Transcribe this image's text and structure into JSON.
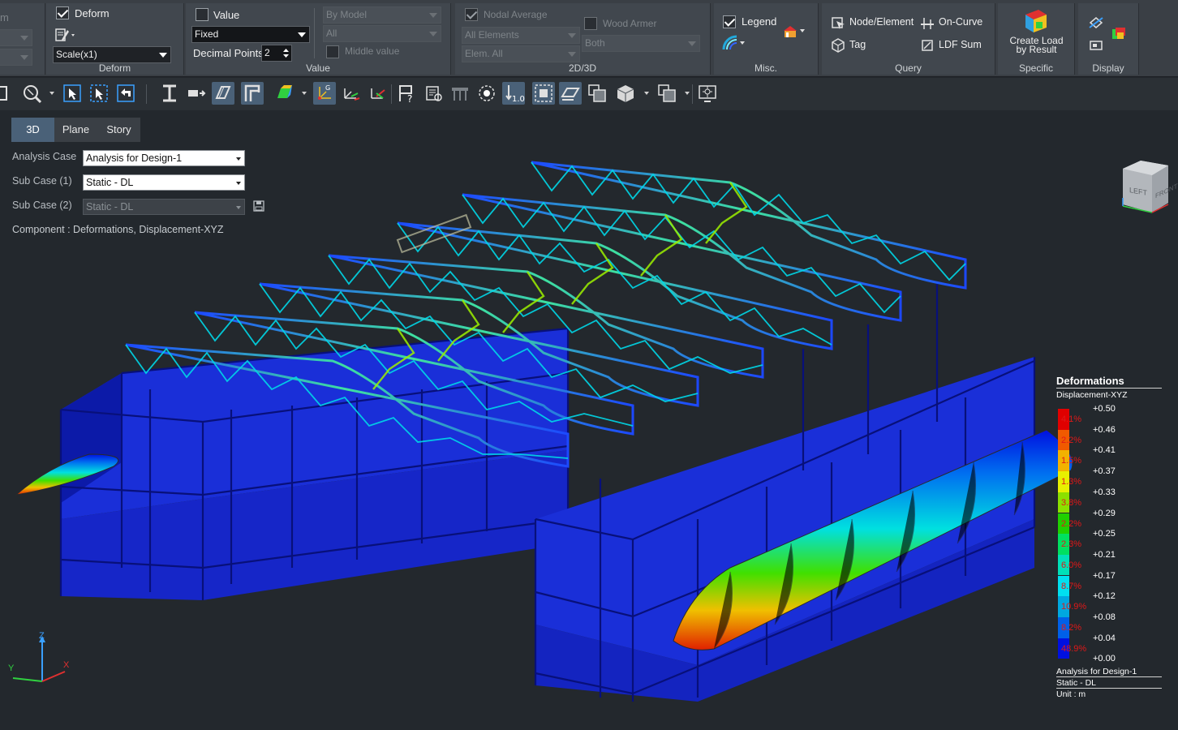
{
  "ribbon": {
    "deform": {
      "label": "Deform",
      "checked": true,
      "scale": "Scale(x1)",
      "group_label": "Deform"
    },
    "value": {
      "label": "Value",
      "checked": false,
      "mode": "Fixed",
      "decimal_points_label": "Decimal Points",
      "decimal_points": "2",
      "by_model": "By Model",
      "all": "All",
      "middle_value_label": "Middle value",
      "group_label": "Value"
    },
    "view2d3d": {
      "nodal_average_label": "Nodal Average",
      "all_elements": "All Elements",
      "elem_all": "Elem. All",
      "wood_armer_label": "Wood Armer",
      "both": "Both",
      "group_label": "2D/3D"
    },
    "misc": {
      "legend_label": "Legend",
      "group_label": "Misc."
    },
    "query": {
      "node_element": "Node/Element",
      "on_curve": "On-Curve",
      "tag": "Tag",
      "ldf_sum": "LDF Sum",
      "group_label": "Query"
    },
    "specific": {
      "create_load_line1": "Create Load",
      "create_load_line2": "by Result",
      "group_label": "Specific"
    },
    "display": {
      "group_label": "Display"
    },
    "left_partial_text": "m"
  },
  "view_tabs": [
    "3D",
    "Plane",
    "Story"
  ],
  "panel": {
    "analysis_case_label": "Analysis Case",
    "analysis_case": "Analysis for Design-1",
    "sub_case1_label": "Sub Case (1)",
    "sub_case1": "Static - DL",
    "sub_case2_label": "Sub Case (2)",
    "sub_case2": "Static - DL",
    "component": "Component : Deformations, Displacement-XYZ"
  },
  "legend": {
    "title": "Deformations",
    "subtitle": "Displacement-XYZ",
    "values": [
      "+0.50",
      "+0.46",
      "+0.41",
      "+0.37",
      "+0.33",
      "+0.29",
      "+0.25",
      "+0.21",
      "+0.17",
      "+0.12",
      "+0.08",
      "+0.04",
      "+0.00"
    ],
    "percents": [
      "4.1%",
      "2.2%",
      "1.5%",
      "1.3%",
      "3.8%",
      "2.2%",
      "2.3%",
      "6.0%",
      "8.7%",
      "10.9%",
      "8.2%",
      "48.9%"
    ],
    "colors": [
      "#e00000",
      "#f05a00",
      "#f2b200",
      "#e8f000",
      "#8ce000",
      "#20d000",
      "#00e060",
      "#00e0b8",
      "#00e0f0",
      "#00a8e0",
      "#0060e8",
      "#0010e0"
    ],
    "analysis": "Analysis for Design-1",
    "subcase": "Static - DL",
    "unit": "Unit : m"
  },
  "view_cube": {
    "left": "LEFT",
    "front": "FRONT"
  },
  "axes": {
    "x": "X",
    "y": "Y",
    "z": "Z"
  }
}
